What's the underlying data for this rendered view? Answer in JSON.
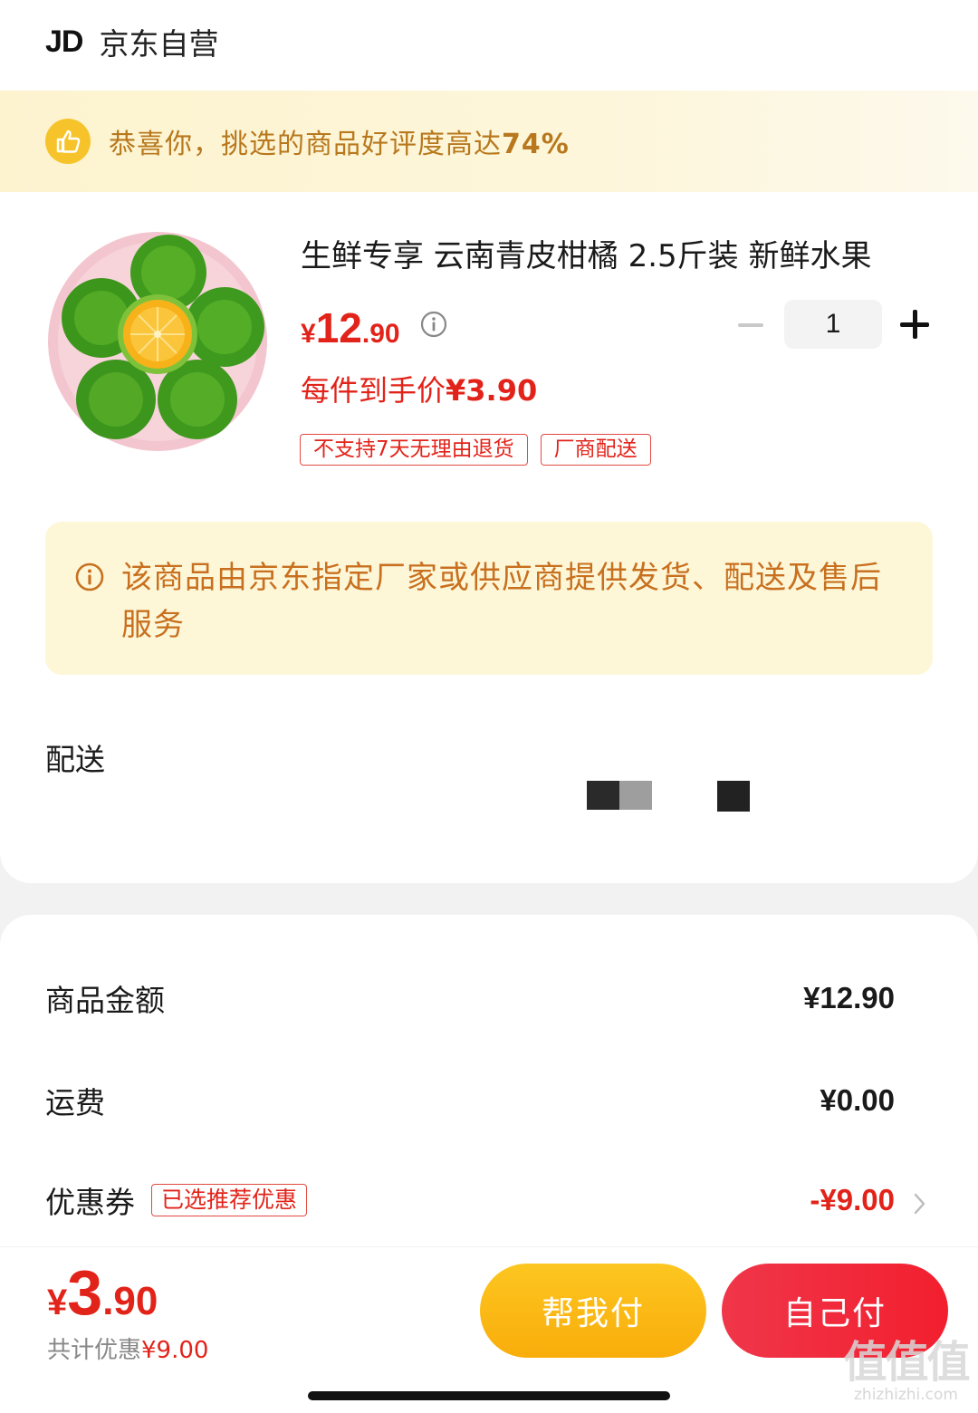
{
  "shop": {
    "logo": "JD",
    "name": "京东自营"
  },
  "banner": {
    "text": "恭喜你，挑选的商品好评度高达",
    "highlight": "74%"
  },
  "product": {
    "title": "生鲜专享 云南青皮柑橘 2.5斤装 新鲜水果",
    "price_currency": "¥",
    "price_int": "12",
    "price_dec": ".90",
    "quantity": "1",
    "per_price_label": "每件到手价",
    "per_price_value": "¥3.90",
    "tags": [
      "不支持7天无理由退货",
      "厂商配送"
    ]
  },
  "notice": {
    "text": "该商品由京东指定厂家或供应商提供发货、配送及售后服务"
  },
  "delivery": {
    "label": "配送"
  },
  "summary": {
    "goods_label": "商品金额",
    "goods_value": "¥12.90",
    "shipping_label": "运费",
    "shipping_value": "¥0.00",
    "coupon_label": "优惠券",
    "coupon_tag": "已选推荐优惠",
    "coupon_value": "-¥9.00"
  },
  "footer": {
    "total_currency": "¥",
    "total_int": "3",
    "total_dec": ".90",
    "saved_label": "共计优惠",
    "saved_value": "¥9.00",
    "help_pay": "帮我付",
    "self_pay": "自己付"
  },
  "watermark": {
    "big": "值值值",
    "small": "zhizhizhi.com"
  },
  "colors": {
    "accent_red": "#e2231a",
    "banner_text": "#b8781d",
    "notice_text": "#c8701f",
    "help_button": "#fdc620",
    "self_button": "#f0364a"
  }
}
